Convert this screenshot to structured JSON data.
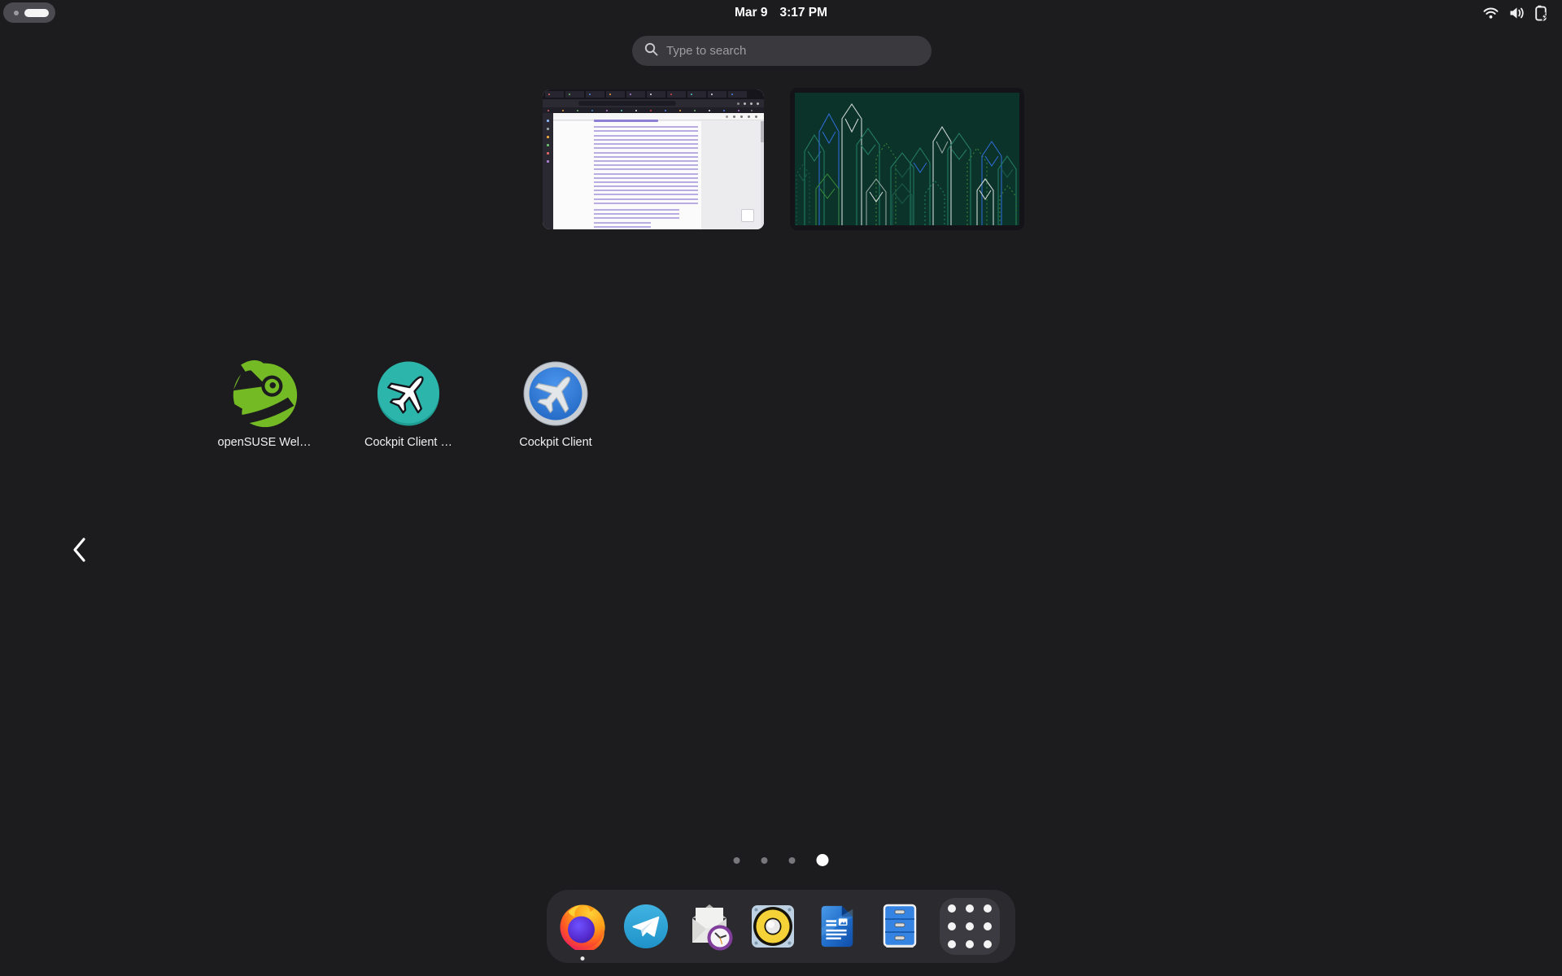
{
  "top_bar": {
    "clock_date": "Mar 9",
    "clock_time": "3:17 PM",
    "workspace_indicator": {
      "total": 2,
      "active": 2
    },
    "status_icons": [
      "wifi-icon",
      "volume-icon",
      "battery-charging-icon"
    ]
  },
  "search": {
    "placeholder": "Type to search"
  },
  "workspaces": {
    "thumbnails": [
      {
        "name": "firefox-document-window"
      },
      {
        "name": "terminal-skyline-art"
      }
    ]
  },
  "app_grid": {
    "apps": [
      {
        "label": "openSUSE Wel…",
        "icon": "opensuse-geeko-icon"
      },
      {
        "label": "Cockpit Client …",
        "icon": "cockpit-client-teal-icon"
      },
      {
        "label": "Cockpit Client",
        "icon": "cockpit-client-blue-icon"
      }
    ],
    "pager": {
      "pages": 4,
      "active_page": 4
    }
  },
  "dock": {
    "items": [
      {
        "name": "firefox",
        "icon": "firefox-icon",
        "running": true
      },
      {
        "name": "telegram",
        "icon": "telegram-icon",
        "running": false
      },
      {
        "name": "mail-clock",
        "icon": "envelope-clock-icon",
        "running": false
      },
      {
        "name": "audio-player",
        "icon": "speaker-icon",
        "running": false
      },
      {
        "name": "libreoffice-writer",
        "icon": "writer-document-icon",
        "running": false
      },
      {
        "name": "file-cabinet",
        "icon": "file-cabinet-icon",
        "running": false
      },
      {
        "name": "show-apps",
        "icon": "app-grid-icon",
        "running": false
      }
    ]
  },
  "colors": {
    "background": "#1c1c1f",
    "dock_background": "#2b2b2f",
    "search_background": "#3a3a3e",
    "terminal_background": "#0c332a",
    "suse_green": "#73ba25",
    "cockpit_teal": "#2cb5aa",
    "cockpit_blue": "#3584e4"
  }
}
